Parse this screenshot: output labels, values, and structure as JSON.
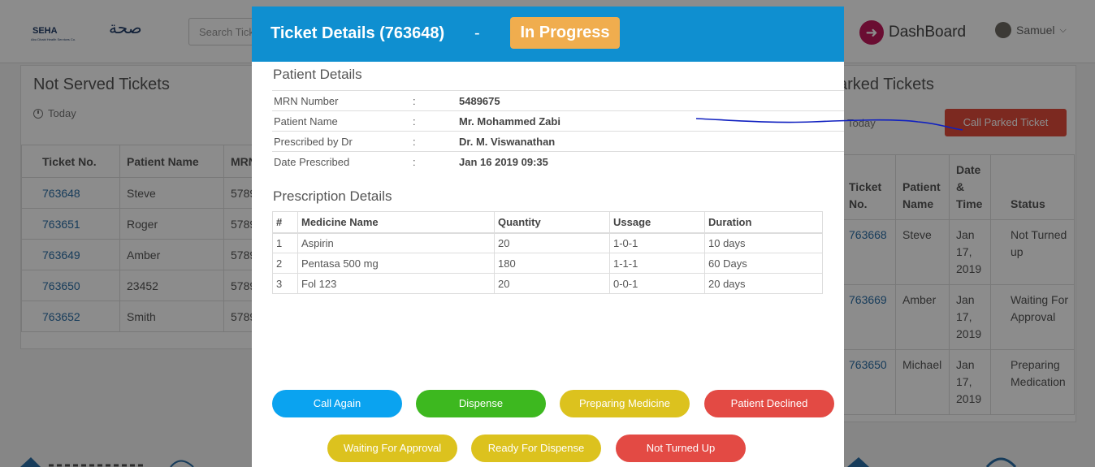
{
  "header": {
    "logo_text": "SEHA",
    "logo_subtext": "Abu Dhabi Health Services Co.",
    "logo_arabic": "صحة",
    "search_placeholder": "Search Tick",
    "dashboard_label": "DashBoard",
    "user_name": "Samuel"
  },
  "left_panel": {
    "title": "Not Served Tickets",
    "period": "Today",
    "columns": [
      "Ticket No.",
      "Patient Name",
      "MRN"
    ],
    "rows": [
      {
        "ticket": "763648",
        "name": "Steve",
        "mrn": "5789"
      },
      {
        "ticket": "763651",
        "name": "Roger",
        "mrn": "5789"
      },
      {
        "ticket": "763649",
        "name": "Amber",
        "mrn": "5789"
      },
      {
        "ticket": "763650",
        "name": "23452",
        "mrn": "5789"
      },
      {
        "ticket": "763652",
        "name": "Smith",
        "mrn": "5789"
      }
    ]
  },
  "right_panel": {
    "title": "arked Tickets",
    "period": "Today",
    "call_parked_label": "Call Parked Ticket",
    "columns": [
      "Ticket No.",
      "Patient Name",
      "Date & Time",
      "Status"
    ],
    "rows": [
      {
        "ticket": "763668",
        "name": "Steve",
        "date": "Jan 17, 2019",
        "status": "Not Turned up"
      },
      {
        "ticket": "763669",
        "name": "Amber",
        "date": "Jan 17, 2019",
        "status": "Waiting For Approval"
      },
      {
        "ticket": "763650",
        "name": "Michael",
        "date": "Jan 17, 2019",
        "status": "Preparing Medication"
      }
    ]
  },
  "modal": {
    "title": "Ticket Details (763648)",
    "separator": "-",
    "status": "In Progress",
    "status_color": "#f0ad4e",
    "header_color": "#0f8fd0",
    "patient_section_title": "Patient Details",
    "patient_details": [
      {
        "label": "MRN Number",
        "value": "5489675"
      },
      {
        "label": "Patient Name",
        "value": "Mr. Mohammed Zabi"
      },
      {
        "label": "Prescribed by Dr",
        "value": "Dr. M. Viswanathan"
      },
      {
        "label": "Date Prescribed",
        "value": "Jan 16 2019 09:35"
      }
    ],
    "colon": ":",
    "prescription_section_title": "Prescription Details",
    "prescription_columns": [
      "#",
      "Medicine Name",
      "Quantity",
      "Ussage",
      "Duration"
    ],
    "prescriptions": [
      {
        "no": "1",
        "medicine": "Aspirin",
        "quantity": "20",
        "usage": "1-0-1",
        "duration": "10 days"
      },
      {
        "no": "2",
        "medicine": "Pentasa 500 mg",
        "quantity": "180",
        "usage": "1-1-1",
        "duration": "60 Days"
      },
      {
        "no": "3",
        "medicine": "Fol 123",
        "quantity": "20",
        "usage": "0-0-1",
        "duration": "20 days"
      }
    ],
    "actions": {
      "call_again": "Call Again",
      "dispense": "Dispense",
      "preparing": "Preparing Medicine",
      "declined": "Patient Declined",
      "waiting": "Waiting For Approval",
      "ready": "Ready For Dispense",
      "not_turned_up": "Not Turned Up"
    }
  }
}
